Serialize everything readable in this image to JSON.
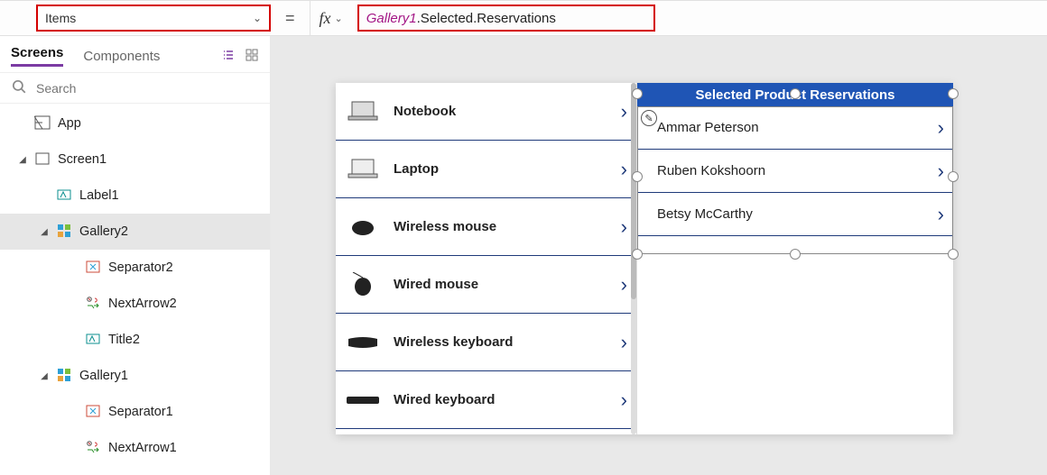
{
  "formula": {
    "property": "Items",
    "object_token": "Gallery1",
    "rest": ".Selected.Reservations"
  },
  "tabs": {
    "screens": "Screens",
    "components": "Components"
  },
  "search": {
    "placeholder": "Search"
  },
  "tree": {
    "app": "App",
    "screen1": "Screen1",
    "label1": "Label1",
    "gallery2": "Gallery2",
    "separator2": "Separator2",
    "nextarrow2": "NextArrow2",
    "title2": "Title2",
    "gallery1": "Gallery1",
    "separator1": "Separator1",
    "nextarrow1": "NextArrow1"
  },
  "gallery1": {
    "items": [
      {
        "label": "Notebook"
      },
      {
        "label": "Laptop"
      },
      {
        "label": "Wireless mouse"
      },
      {
        "label": "Wired mouse"
      },
      {
        "label": "Wireless keyboard"
      },
      {
        "label": "Wired keyboard"
      }
    ]
  },
  "gallery2": {
    "header": "Selected Product Reservations",
    "items": [
      {
        "label": "Ammar Peterson"
      },
      {
        "label": "Ruben Kokshoorn"
      },
      {
        "label": "Betsy McCarthy"
      }
    ]
  }
}
